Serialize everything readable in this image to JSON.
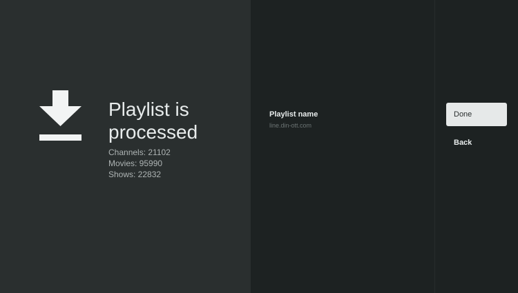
{
  "info": {
    "icon": "download-icon",
    "title": "Playlist is processed",
    "stats": [
      "Channels: 21102",
      "Movies: 95990",
      "Shows: 22832"
    ]
  },
  "details": {
    "playlist_name_label": "Playlist name",
    "playlist_name_value": "line.din-ott.com"
  },
  "actions": {
    "done_label": "Done",
    "back_label": "Back"
  },
  "colors": {
    "left_panel": "#2a2f2f",
    "background": "#1d2222",
    "focused_button": "#e6e9e9"
  }
}
